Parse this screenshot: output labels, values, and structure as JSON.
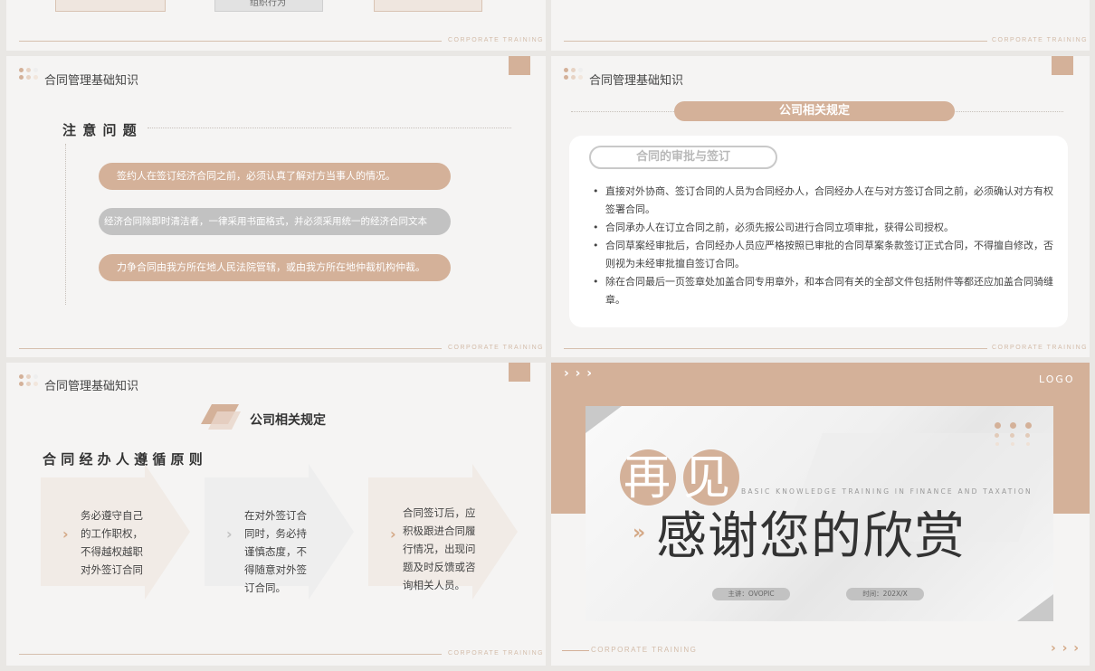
{
  "slide0": {
    "button_label": "组织行为",
    "footer": "CORPORATE TRAINING"
  },
  "slide1": {
    "footer": "CORPORATE TRAINING"
  },
  "slide2": {
    "header": "合同管理基础知识",
    "section_title": "注 意 问 题",
    "pills": [
      "签约人在签订经济合同之前，必须认真了解对方当事人的情况。",
      "经济合同除即时清洁者，一律采用书面格式，并必须采用统一的经济合同文本",
      "力争合同由我方所在地人民法院管辖，或由我方所在地仲裁机构仲裁。"
    ],
    "footer": "CORPORATE TRAINING"
  },
  "slide3": {
    "header": "合同管理基础知识",
    "banner": "公司相关规定",
    "card_title": "合同的审批与签订",
    "bullets": [
      "直接对外协商、签订合同的人员为合同经办人，合同经办人在与对方签订合同之前，必须确认对方有权签署合同。",
      "合同承办人在订立合同之前，必须先报公司进行合同立项审批，获得公司授权。",
      "合同草案经审批后，合同经办人员应严格按照已审批的合同草案条款签订正式合同，不得擅自修改，否则视为未经审批擅自签订合同。",
      "除在合同最后一页签章处加盖合同专用章外，和本合同有关的全部文件包括附件等都还应加盖合同骑缝章。"
    ],
    "footer": "CORPORATE TRAINING"
  },
  "slide4": {
    "header": "合同管理基础知识",
    "banner": "公司相关规定",
    "subtitle": "合 同 经 办 人 遵 循 原 则",
    "items": [
      [
        "务必遵守自己",
        "的工作职权，",
        "不得越权越职",
        "对外签订合同"
      ],
      [
        "在对外签订合",
        "同时，务必持",
        "谨慎态度，不",
        "得随意对外签",
        "订合同。"
      ],
      [
        "合同签订后，应",
        "积极跟进合同履",
        "行情况，出现问",
        "题及时反馈或咨",
        "询相关人员。"
      ]
    ],
    "footer": "CORPORATE TRAINING"
  },
  "slide5": {
    "logo": "LOGO",
    "big_title": "再见",
    "english": "BASIC KNOWLEDGE TRAINING IN FINANCE AND TAXATION",
    "thanks": "感谢您的欣赏",
    "speaker": "主讲：OVOPIC",
    "time": "时间：202X/X",
    "footer": "CORPORATE TRAINING",
    "arrows_top": "› › ›",
    "arrows_bottom": "› › ›"
  },
  "colors": {
    "accent": "#d4b199",
    "accent_dark": "#c9a386",
    "gray_pill": "#c2c2c2"
  }
}
